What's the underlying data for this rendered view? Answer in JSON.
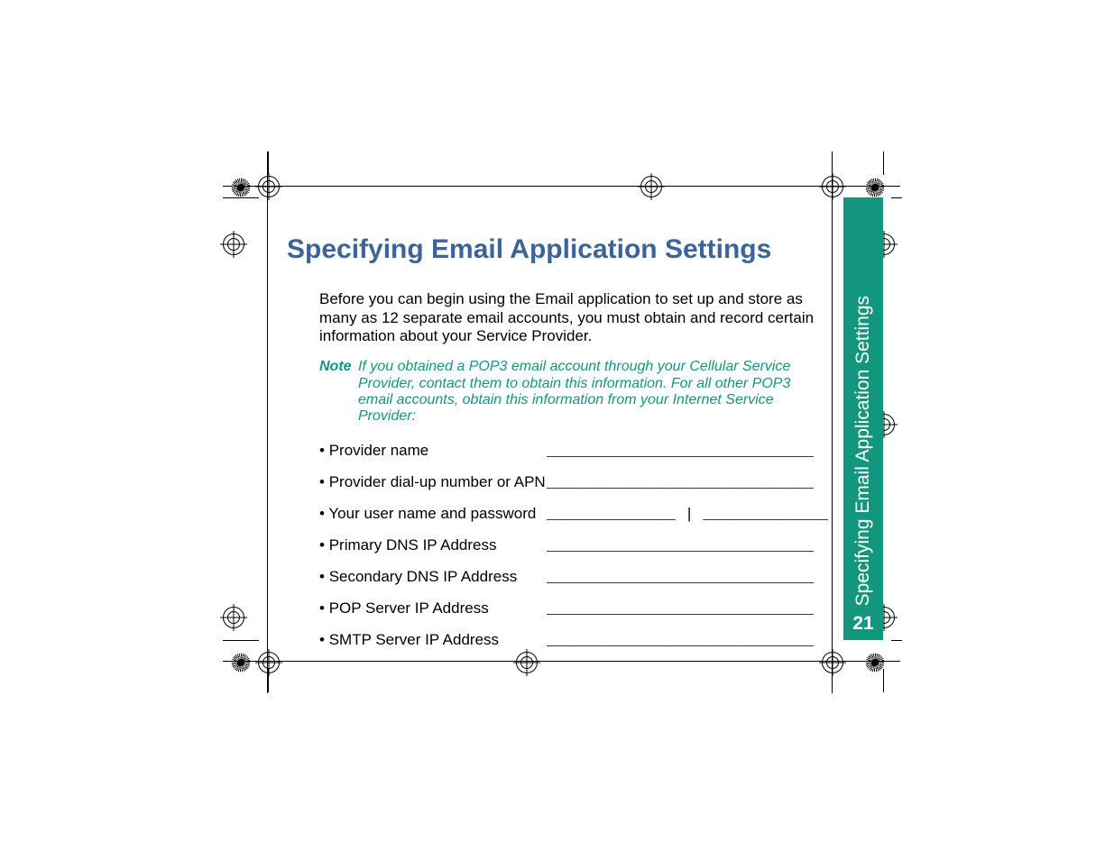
{
  "title": "Specifying Email Application Settings",
  "intro": "Before you can begin using the Email application to set up and store as many as 12 separate email accounts, you must obtain and record certain information about your Service Provider.",
  "note": {
    "label": "Note",
    "text": "If you obtained a POP3 email account through your Cellular Service Provider, contact them to obtain this information. For all other POP3 email accounts, obtain this information from your Internet Service Provider:"
  },
  "fields": [
    {
      "label": "Provider name",
      "line": "_____________________________"
    },
    {
      "label": "Provider dial-up number or APN",
      "line": "_____________________________"
    },
    {
      "label": "Your user name and password",
      "line": "______________ | ______________"
    },
    {
      "label": "Primary DNS IP Address",
      "line": "_____________________________"
    },
    {
      "label": "Secondary DNS IP Address",
      "line": "_____________________________"
    },
    {
      "label": "POP Server IP Address",
      "line": "_____________________________"
    },
    {
      "label": "SMTP Server IP Address",
      "line": "_____________________________"
    }
  ],
  "sidetab": {
    "text": "Specifying Email Application Settings",
    "page": "21"
  }
}
